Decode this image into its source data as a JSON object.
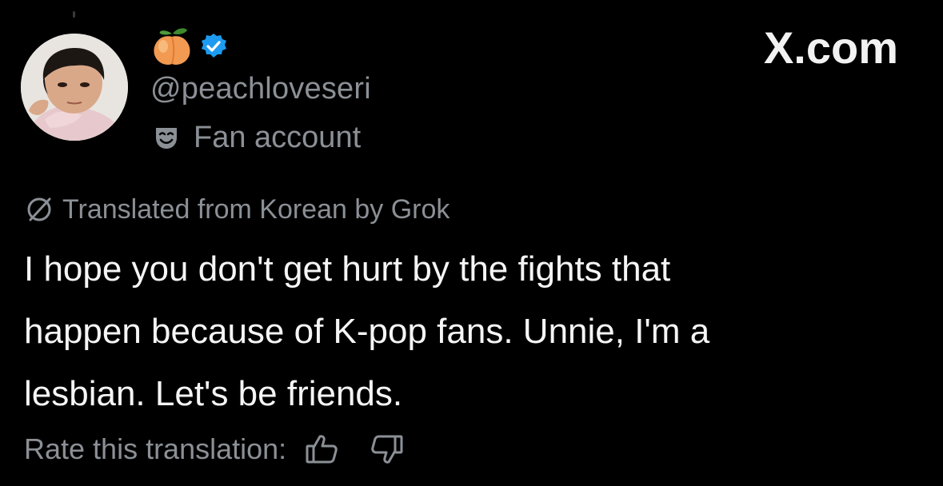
{
  "profile": {
    "avatar_icon": "avatar-photo",
    "name_icons": [
      "peach-emoji-icon",
      "verified-badge-icon"
    ],
    "handle": "@peachloveseri",
    "account_label": "Fan account",
    "account_label_icon": "mask-icon"
  },
  "watermark": {
    "text": "X.com"
  },
  "translation": {
    "notice": "Translated from Korean by Grok",
    "notice_icon": "slash-circle-icon",
    "body_lines": [
      "I hope you don't get hurt by the fights that",
      "happen because of K-pop fans. Unnie, I'm a",
      "lesbian. Let's be friends."
    ],
    "rate_label": "Rate this translation:",
    "rate_icons": [
      "thumbs-up-icon",
      "thumbs-down-icon"
    ]
  },
  "colors": {
    "background": "#000000",
    "text_primary": "#f5f5f5",
    "text_secondary": "#8b9096",
    "verified_blue": "#1d9bf0",
    "peach": "#f39a52"
  }
}
